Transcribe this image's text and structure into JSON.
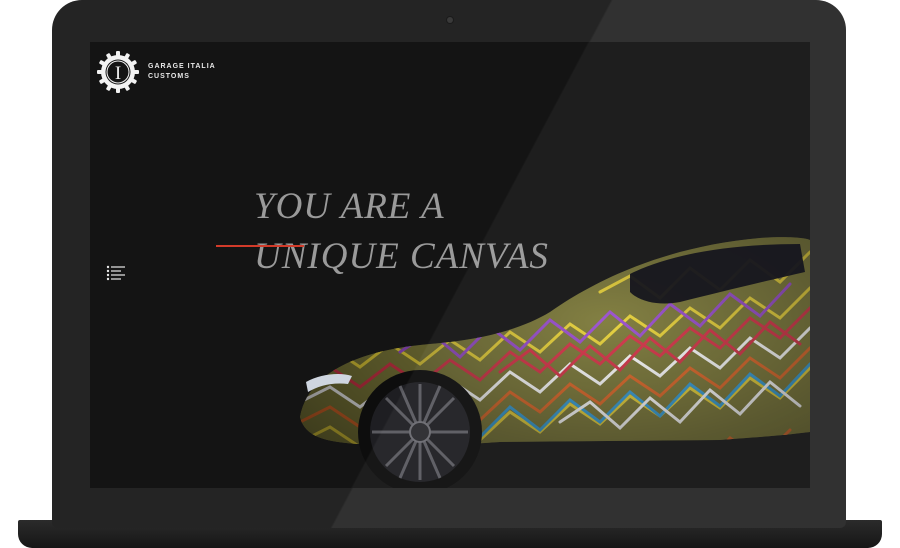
{
  "brand": {
    "line1": "GARAGE ITALIA",
    "line2": "CUSTOMS",
    "logo_letter": "I"
  },
  "hero": {
    "headline_line1": "YOU ARE A",
    "headline_line2": "UNIQUE CANVAS"
  },
  "icons": {
    "logo": "gear-badge-icon",
    "menu": "menu-list-icon",
    "hero_image": "art-car-image"
  },
  "colors": {
    "screen_background": "#141414",
    "laptop_frame": "#242424",
    "headline": "#9a9a9a",
    "accent_line": "#d23b2a",
    "brand_text": "#e8e8e8"
  }
}
